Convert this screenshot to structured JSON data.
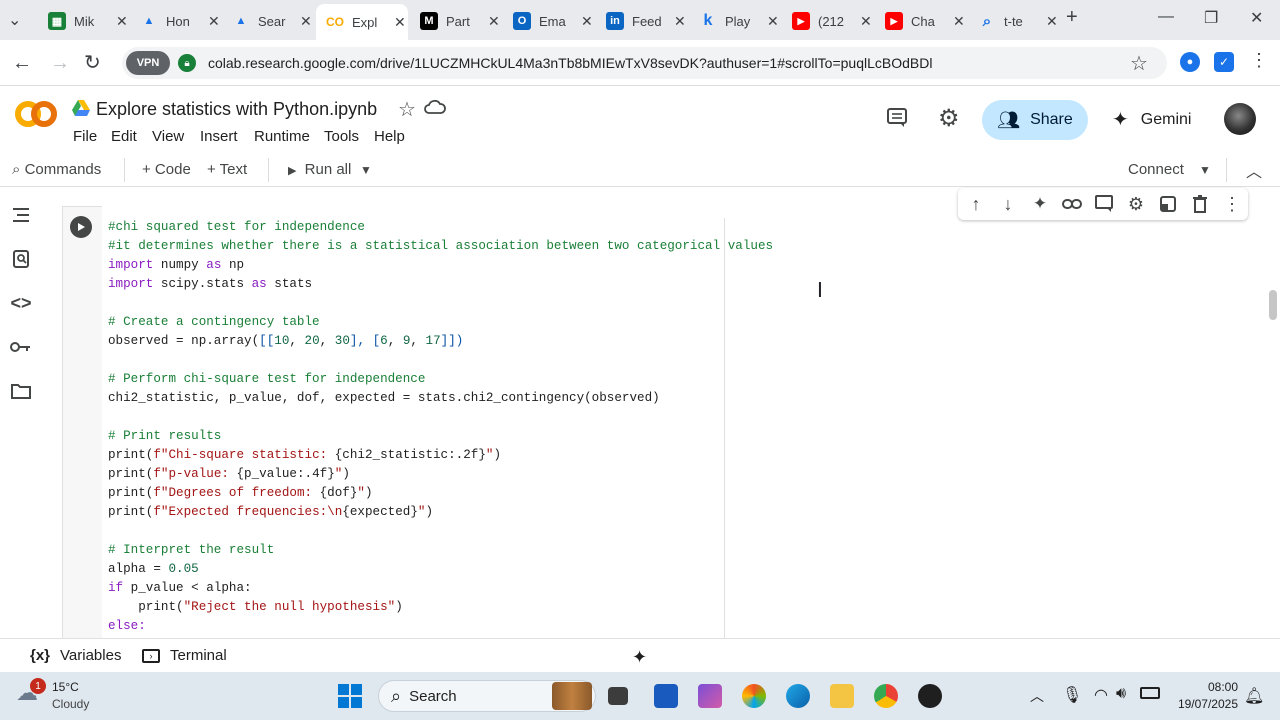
{
  "browser": {
    "tabs": [
      {
        "label": "Mik",
        "color": "#188038",
        "glyph": "▦"
      },
      {
        "label": "Hon",
        "color": "#1a73e8",
        "glyph": "▲"
      },
      {
        "label": "Sear",
        "color": "#1a73e8",
        "glyph": "▲"
      },
      {
        "label": "Expl",
        "color": "#f9ab00",
        "glyph": "CO"
      },
      {
        "label": "Part",
        "color": "#000000",
        "glyph": "M"
      },
      {
        "label": "Ema",
        "color": "#0a66c2",
        "glyph": "O"
      },
      {
        "label": "Feed",
        "color": "#0a66c2",
        "glyph": "in"
      },
      {
        "label": "Play",
        "color": "#1a73e8",
        "glyph": "k"
      },
      {
        "label": "(212",
        "color": "#ff0000",
        "glyph": "▶"
      },
      {
        "label": "Cha",
        "color": "#ff0000",
        "glyph": "▶"
      },
      {
        "label": "t-te",
        "color": "#1a73e8",
        "glyph": "⌕"
      }
    ],
    "new_tab": "+",
    "vpn_label": "VPN",
    "url": "colab.research.google.com/drive/1LUCZMHCkUL4Ma3nTb8bMIEwTxV8sevDK?authuser=1#scrollTo=puqlLcBOdBDl"
  },
  "colab": {
    "title": "Explore statistics with Python.ipynb",
    "menu": [
      "File",
      "Edit",
      "View",
      "Insert",
      "Runtime",
      "Tools",
      "Help"
    ],
    "share_label": "Share",
    "gemini_label": "Gemini",
    "commands_label": "Commands",
    "code_label": "+ Code",
    "text_label": "+ Text",
    "run_all_label": "Run all",
    "connect_label": "Connect"
  },
  "code": {
    "l1": "#chi squared test for independence",
    "l2": "#it determines whether there is a statistical association between two categorical values",
    "l3a": "import",
    "l3b": " numpy ",
    "l3c": "as",
    "l3d": " np",
    "l4a": "import",
    "l4b": " scipy.stats ",
    "l4c": "as",
    "l4d": " stats",
    "l6": "# Create a contingency table",
    "l7a": "observed = np.array(",
    "l7b": "[[",
    "l7c": "10",
    "l7d": ", ",
    "l7e": "20",
    "l7f": ", ",
    "l7g": "30",
    "l7h": "], [",
    "l7i": "6",
    "l7j": ", ",
    "l7k": "9",
    "l7l": ", ",
    "l7m": "17",
    "l7n": "]])",
    "l9": "# Perform chi-square test for independence",
    "l10": "chi2_statistic, p_value, dof, expected = stats.chi2_contingency(observed)",
    "l12": "# Print results",
    "l13a": "print(",
    "l13b": "f\"Chi-square statistic: ",
    "l13c": "{chi2_statistic:.2f}",
    "l13d": "\"",
    "l13e": ")",
    "l14a": "print(",
    "l14b": "f\"p-value: ",
    "l14c": "{p_value:.4f}",
    "l14d": "\"",
    "l14e": ")",
    "l15a": "print(",
    "l15b": "f\"Degrees of freedom: ",
    "l15c": "{dof}",
    "l15d": "\"",
    "l15e": ")",
    "l16a": "print(",
    "l16b": "f\"Expected frequencies:\\n",
    "l16c": "{expected}",
    "l16d": "\"",
    "l16e": ")",
    "l18": "# Interpret the result",
    "l19a": "alpha = ",
    "l19b": "0.05",
    "l20a": "if",
    "l20b": " p_value < alpha:",
    "l21a": "    print(",
    "l21b": "\"Reject the null hypothesis\"",
    "l21c": ")",
    "l22": "else:"
  },
  "bottom": {
    "variables_label": "Variables",
    "terminal_label": "Terminal"
  },
  "taskbar": {
    "weather_temp": "15°C",
    "weather_desc": "Cloudy",
    "weather_badge": "1",
    "search_label": "Search",
    "time": "08:00",
    "date": "19/07/2025"
  }
}
